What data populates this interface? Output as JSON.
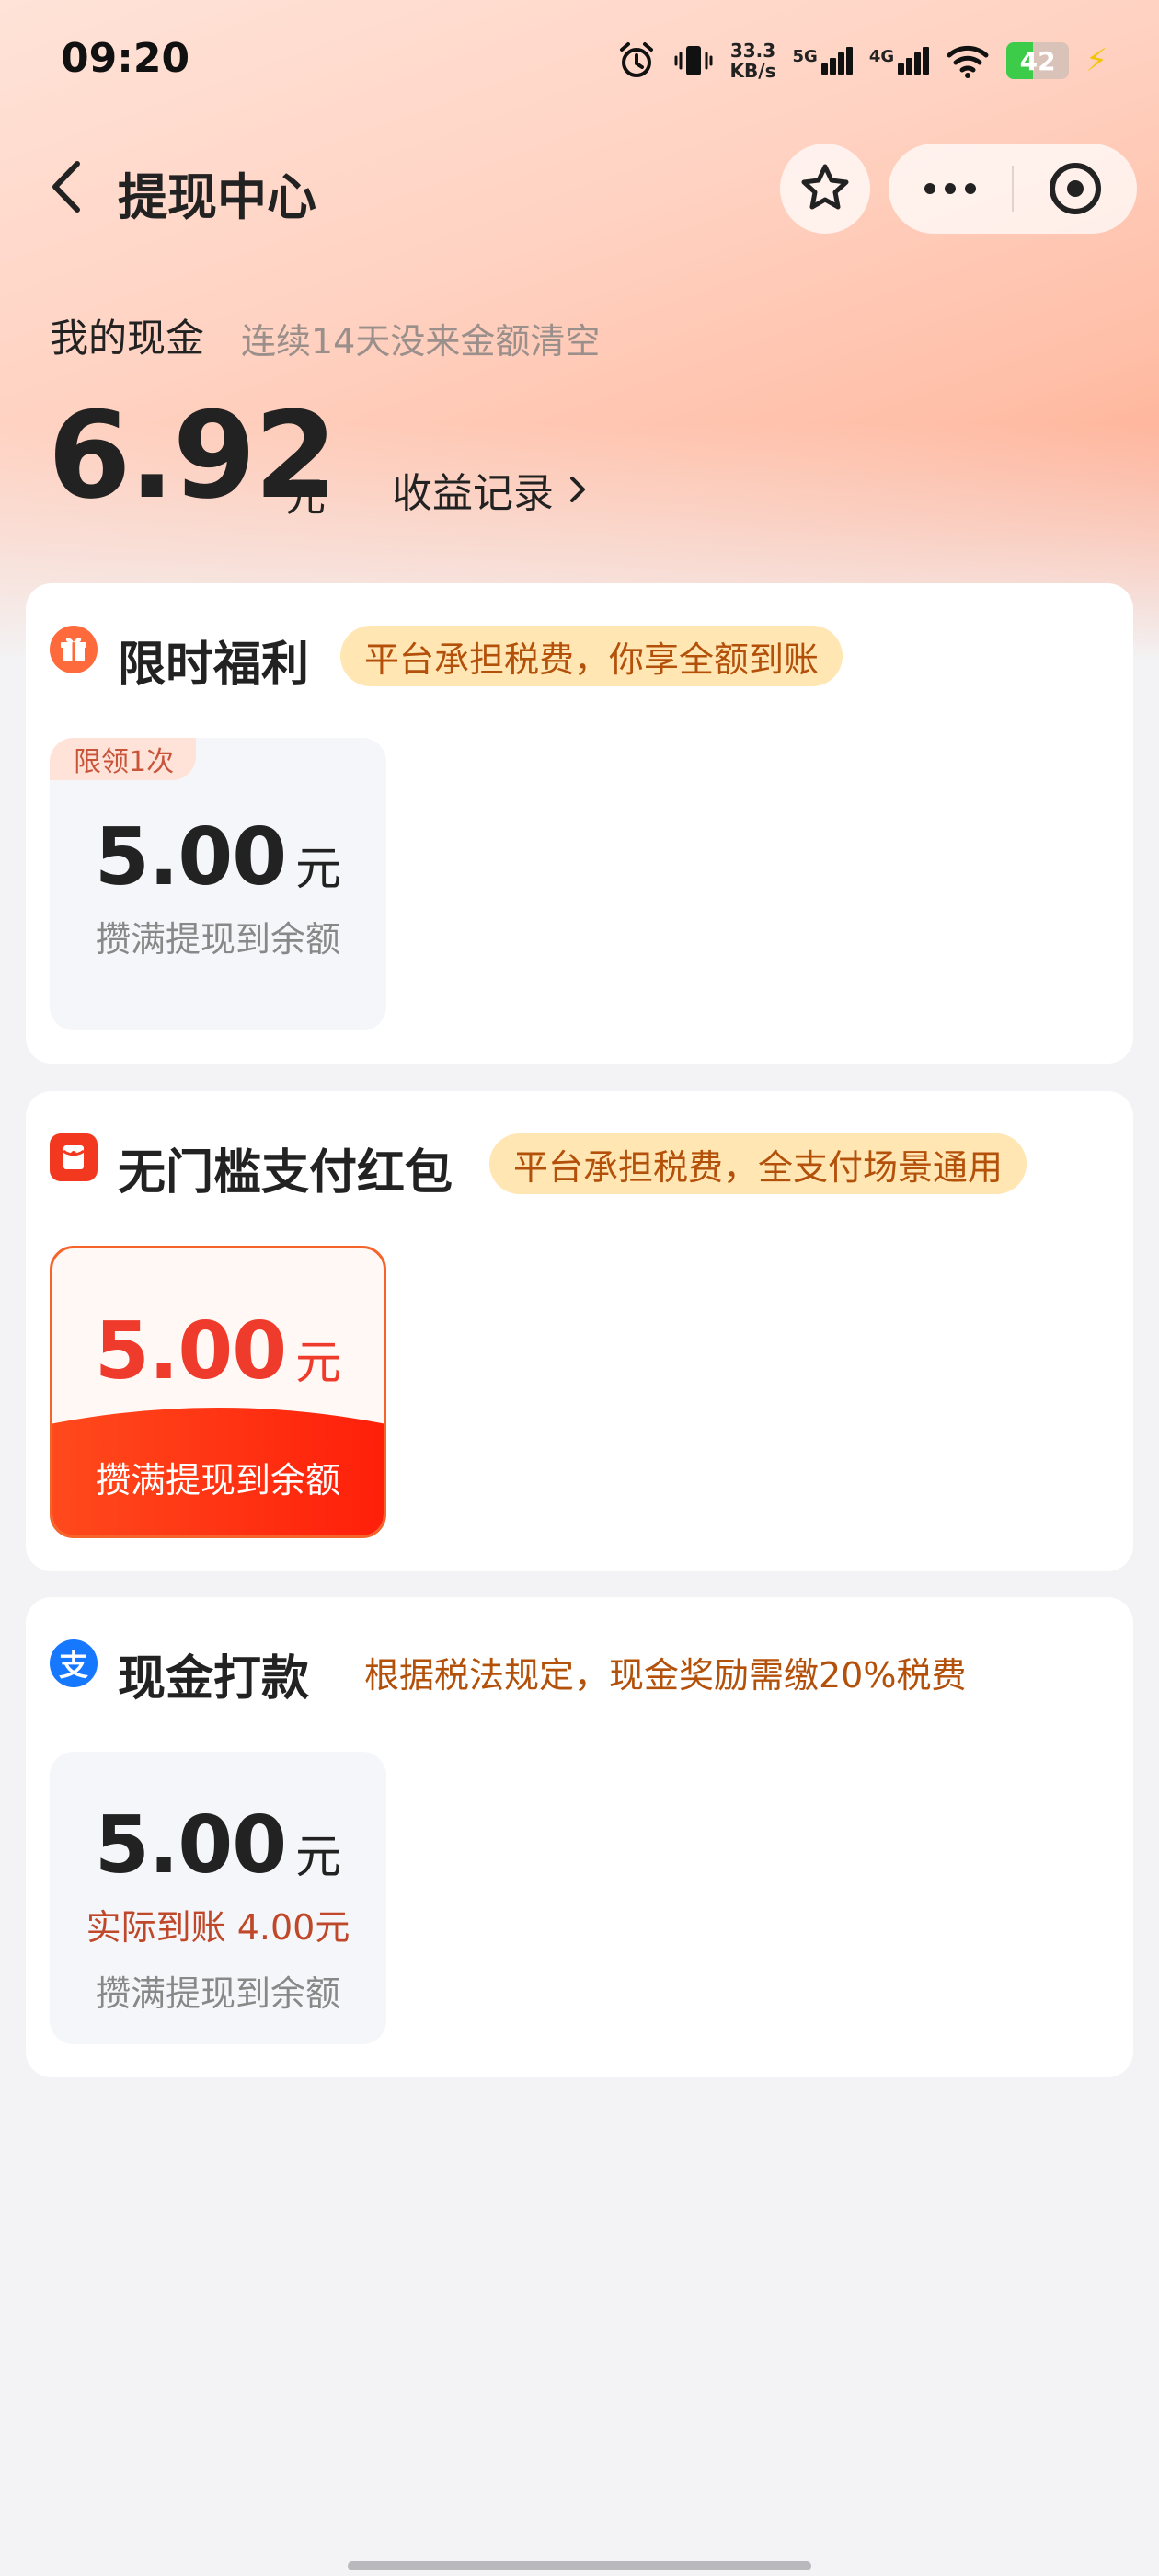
{
  "status_bar": {
    "time": "09:20",
    "speed_value": "33.3",
    "speed_unit": "KB/s",
    "net1": "5G",
    "net2": "4G",
    "battery": "42",
    "icons": [
      "alarm-icon",
      "vibrate-icon",
      "signal-icon",
      "wifi-icon",
      "battery-icon",
      "charging-icon"
    ]
  },
  "header": {
    "title": "提现中心",
    "back_icon": "chevron-left-icon",
    "favorite_icon": "star-icon",
    "more_icon": "more-dots-icon",
    "close_icon": "target-icon"
  },
  "cash": {
    "label": "我的现金",
    "note": "连续14天没来金额清空",
    "amount": "6.92",
    "unit": "元",
    "income_link": "收益记录"
  },
  "sections": {
    "limited": {
      "title": "限时福利",
      "pill": "平台承担税费，你享全额到账",
      "icon": "gift-icon",
      "icon_color": "#ff6a3d",
      "tile": {
        "tag": "限领1次",
        "amount": "5.00",
        "unit": "元",
        "caption": "攒满提现到余额"
      }
    },
    "redpacket": {
      "title": "无门槛支付红包",
      "pill": "平台承担税费，全支付场景通用",
      "icon": "red-packet-icon",
      "icon_color": "#f2391f",
      "tile": {
        "amount": "5.00",
        "unit": "元",
        "caption": "攒满提现到余额"
      }
    },
    "cash_transfer": {
      "title": "现金打款",
      "note": "根据税法规定，现金奖励需缴20%税费",
      "icon": "alipay-icon",
      "icon_glyph": "支",
      "icon_color": "#1677ff",
      "tile": {
        "amount": "5.00",
        "unit": "元",
        "actual": "实际到账 4.00元",
        "caption": "攒满提现到余额"
      }
    }
  }
}
